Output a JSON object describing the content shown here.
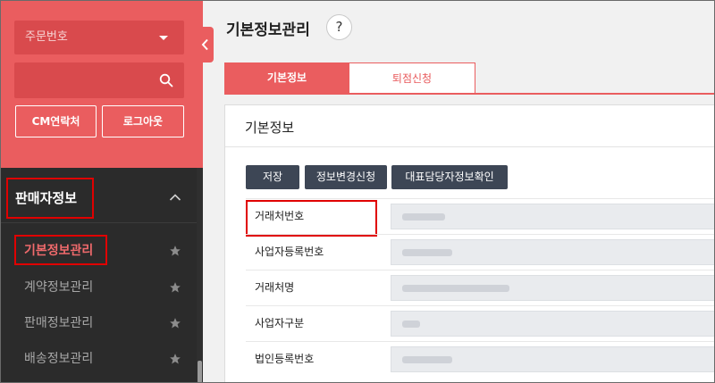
{
  "sidebar": {
    "order_select": {
      "placeholder": "주문번호"
    },
    "search": {
      "value": ""
    },
    "buttons": {
      "cm_contact": "CM연락처",
      "logout": "로그아웃"
    },
    "section": {
      "title": "판매자정보",
      "expanded": true
    },
    "items": [
      {
        "label": "기본정보관리",
        "active": true
      },
      {
        "label": "계약정보관리",
        "active": false
      },
      {
        "label": "판매정보관리",
        "active": false
      },
      {
        "label": "배송정보관리",
        "active": false
      }
    ]
  },
  "main": {
    "page_title": "기본정보관리",
    "help_glyph": "?",
    "tabs": [
      {
        "label": "기본정보",
        "active": true
      },
      {
        "label": "퇴점신청",
        "active": false
      }
    ],
    "panel": {
      "title": "기본정보",
      "actions": {
        "save": "저장",
        "request_change": "정보변경신청",
        "verify_rep": "대표담당자정보확인"
      },
      "fields": [
        {
          "label": "거래처번호",
          "value": ""
        },
        {
          "label": "사업자등록번호",
          "value": ""
        },
        {
          "label": "거래처명",
          "value": ""
        },
        {
          "label": "사업자구분",
          "value": ""
        },
        {
          "label": "법인등록번호",
          "value": ""
        }
      ]
    }
  },
  "colors": {
    "brand_red": "#ea5d5f",
    "sidebar_dark": "#2b2b2b",
    "button_dark": "#3d4655",
    "highlight_box": "#e00000"
  }
}
